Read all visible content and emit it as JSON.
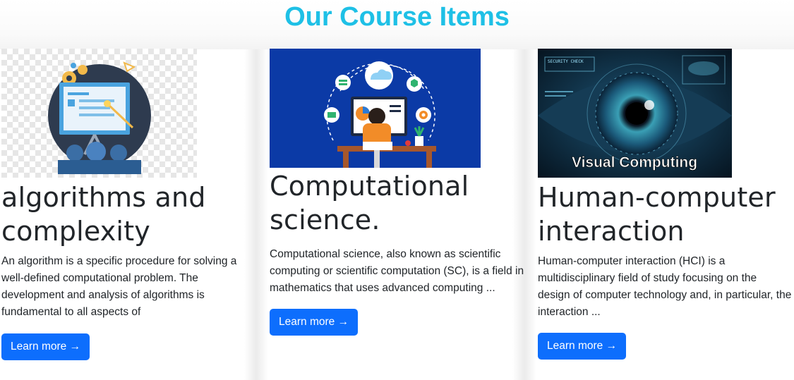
{
  "page_title": "Our Course Items",
  "colors": {
    "title": "#1ec0e6",
    "button": "#0d6efd",
    "text": "#212529"
  },
  "courses": [
    {
      "title": "algorithms and complexity",
      "description": "An algorithm is a specific procedure for solving a well-defined computational problem. The development and analysis of algorithms is fundamental to all aspects of",
      "button_label": "Learn more →",
      "image": "presentation-board-illustration"
    },
    {
      "title": "Computational science.",
      "description": "Computational science, also known as scientific computing or scientific computation (SC), is a field in mathematics that uses advanced computing ...",
      "button_label": "Learn more →",
      "image": "person-at-computer-illustration"
    },
    {
      "title": "Human-computer interaction",
      "description": "Human-computer interaction (HCI) is a multidisciplinary field of study focusing on the design of computer technology and, in particular, the interaction ...",
      "button_label": "Learn more →",
      "image": "eye-visual-computing-photo",
      "image_caption": "Visual Computing",
      "image_hud_label": "SECURITY CHECK"
    }
  ]
}
